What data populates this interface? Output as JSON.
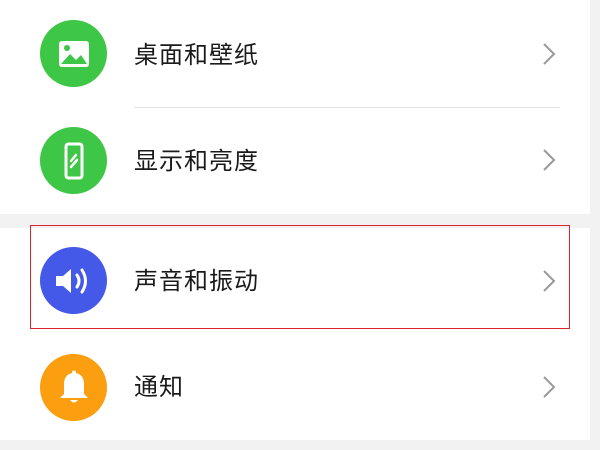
{
  "settings": {
    "items": [
      {
        "label": "桌面和壁纸",
        "icon": "wallpaper-icon",
        "color": "#3ec646"
      },
      {
        "label": "显示和亮度",
        "icon": "display-brightness-icon",
        "color": "#3ec646"
      },
      {
        "label": "声音和振动",
        "icon": "sound-icon",
        "color": "#4559e8"
      },
      {
        "label": "通知",
        "icon": "notification-bell-icon",
        "color": "#fb9e10"
      }
    ],
    "highlighted_item": "声音和振动",
    "highlight_color": "#d9232d",
    "chevron_icon": "chevron-right-icon"
  }
}
